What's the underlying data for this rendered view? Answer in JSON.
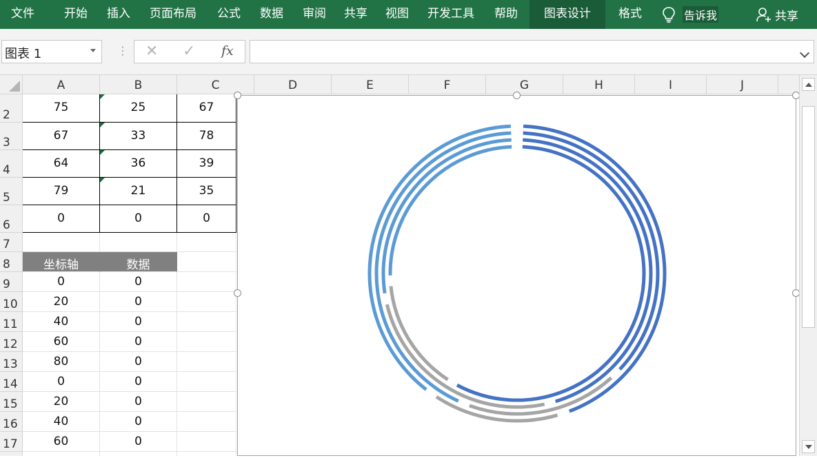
{
  "ribbon": {
    "tabs": [
      "文件",
      "开始",
      "插入",
      "页面布局",
      "公式",
      "数据",
      "审阅",
      "共享",
      "视图",
      "开发工具",
      "帮助",
      "图表设计",
      "格式"
    ],
    "active_tabs": [
      "图表设计"
    ],
    "tell_me": "告诉我",
    "share": "共享",
    "background_color": "#217346"
  },
  "formula_bar": {
    "name_box": "图表 1",
    "cancel_icon": "close-icon",
    "enter_icon": "check-icon",
    "fx_label": "fx",
    "formula_value": ""
  },
  "sheet": {
    "columns": [
      "A",
      "B",
      "C",
      "D",
      "E",
      "F",
      "G",
      "H",
      "I",
      "J"
    ],
    "rows": [
      "2",
      "3",
      "4",
      "5",
      "6",
      "7",
      "8",
      "9",
      "10",
      "11",
      "12",
      "13",
      "14",
      "15",
      "16",
      "17"
    ],
    "table1": [
      [
        "75",
        "25",
        "67"
      ],
      [
        "67",
        "33",
        "78"
      ],
      [
        "64",
        "36",
        "39"
      ],
      [
        "79",
        "21",
        "35"
      ],
      [
        "0",
        "0",
        "0"
      ]
    ],
    "table2_headers": [
      "坐标轴",
      "数据"
    ],
    "table2": [
      [
        "0",
        "0"
      ],
      [
        "20",
        "0"
      ],
      [
        "40",
        "0"
      ],
      [
        "60",
        "0"
      ],
      [
        "80",
        "0"
      ],
      [
        "0",
        "0"
      ],
      [
        "20",
        "0"
      ],
      [
        "40",
        "0"
      ],
      [
        "60",
        "0"
      ]
    ],
    "header_fill": "#808080"
  },
  "chart_data": {
    "type": "doughnut",
    "title": "",
    "legend": "none",
    "ring_count": 4,
    "series": [
      {
        "values": [
          75,
          25,
          67
        ]
      },
      {
        "values": [
          67,
          33,
          78
        ]
      },
      {
        "values": [
          64,
          36,
          39
        ]
      },
      {
        "values": [
          79,
          21,
          35
        ]
      }
    ],
    "colors": [
      "#4472c4",
      "#a5a5a5",
      "#5b9bd5",
      "#264478"
    ]
  }
}
